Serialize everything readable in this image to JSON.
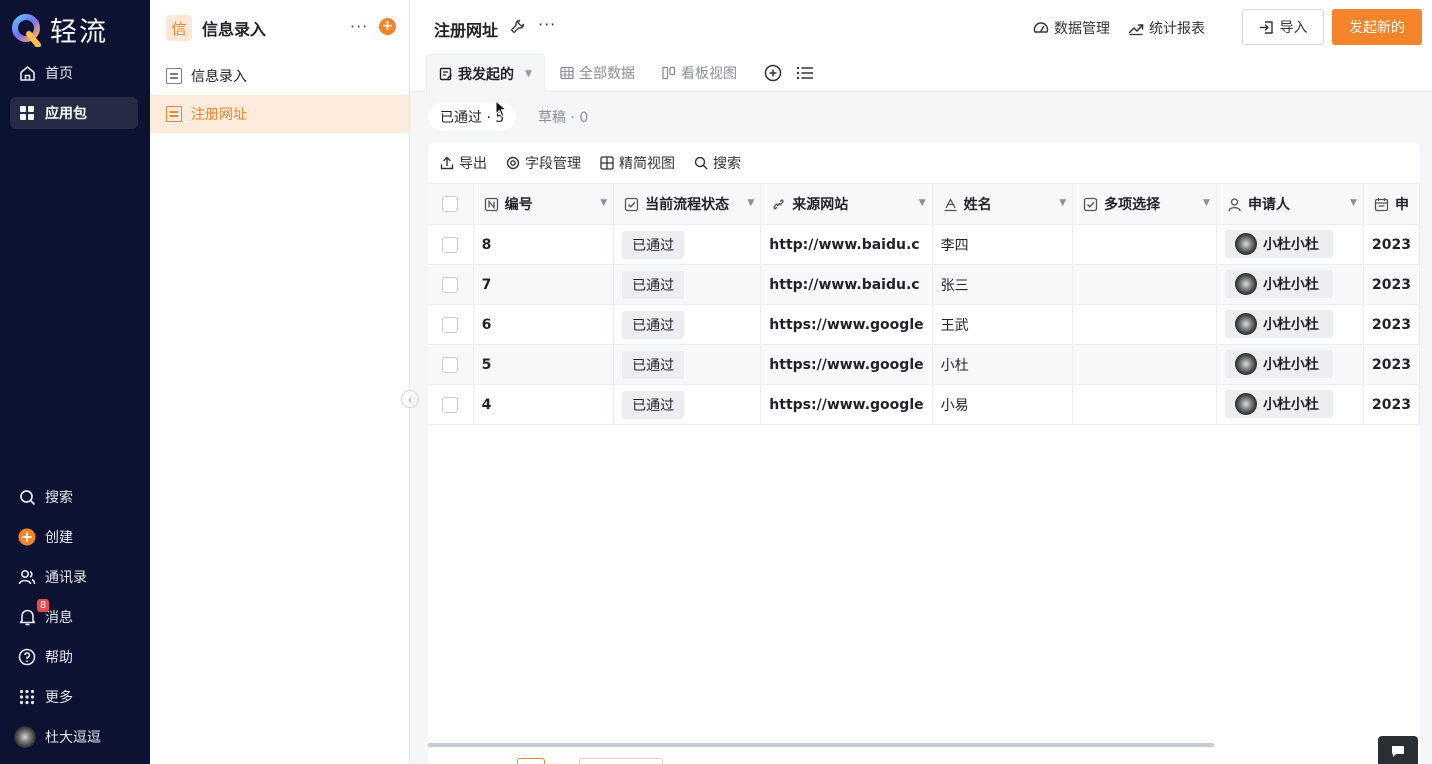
{
  "app": {
    "logo_text": "轻流"
  },
  "rail": {
    "nav": [
      {
        "label": "首页",
        "icon": "home-icon"
      },
      {
        "label": "应用包",
        "icon": "grid-apps-icon",
        "active": true
      }
    ],
    "bottom": [
      {
        "label": "搜索",
        "icon": "search-icon"
      },
      {
        "label": "创建",
        "icon": "plus-circle-icon"
      },
      {
        "label": "通讯录",
        "icon": "contacts-icon"
      },
      {
        "label": "消息",
        "icon": "bell-icon",
        "badge": "8"
      },
      {
        "label": "帮助",
        "icon": "help-icon"
      },
      {
        "label": "更多",
        "icon": "dots-grid-icon"
      }
    ],
    "user": {
      "name": "杜大逗逗"
    }
  },
  "sidebar": {
    "header_icon_char": "信",
    "title": "信息录入",
    "items": [
      {
        "label": "信息录入",
        "active": false
      },
      {
        "label": "注册网址",
        "active": true
      }
    ]
  },
  "header": {
    "title": "注册网址",
    "links": [
      {
        "label": "数据管理",
        "icon": "dashboard-icon"
      },
      {
        "label": "统计报表",
        "icon": "trend-icon"
      }
    ],
    "import_label": "导入",
    "primary_label": "发起新的"
  },
  "view_tabs": [
    {
      "label": "我发起的",
      "icon": "form-icon",
      "active": true
    },
    {
      "label": "全部数据",
      "icon": "table-icon"
    },
    {
      "label": "看板视图",
      "icon": "kanban-icon"
    }
  ],
  "status_pills": {
    "passed": "已通过 · 5",
    "draft": "草稿 · 0"
  },
  "toolbar": {
    "export": "导出",
    "fields": "字段管理",
    "compact": "精简视图",
    "search": "搜索"
  },
  "columns": [
    {
      "label": "编号",
      "icon": "number-field-icon"
    },
    {
      "label": "当前流程状态",
      "icon": "checkbox-field-icon"
    },
    {
      "label": "来源网站",
      "icon": "link-field-icon"
    },
    {
      "label": "姓名",
      "icon": "text-field-icon"
    },
    {
      "label": "多项选择",
      "icon": "checkbox-field-icon"
    },
    {
      "label": "申请人",
      "icon": "person-field-icon"
    },
    {
      "label": "申",
      "icon": "calendar-field-icon"
    }
  ],
  "rows": [
    {
      "id": "8",
      "status": "已通过",
      "url": "http://www.baidu.c",
      "name": "李四",
      "multi": "",
      "applicant": "小杜小杜",
      "date": "2023"
    },
    {
      "id": "7",
      "status": "已通过",
      "url": "http://www.baidu.c",
      "name": "张三",
      "multi": "",
      "applicant": "小杜小杜",
      "date": "2023"
    },
    {
      "id": "6",
      "status": "已通过",
      "url": "https://www.google",
      "name": "王武",
      "multi": "",
      "applicant": "小杜小杜",
      "date": "2023"
    },
    {
      "id": "5",
      "status": "已通过",
      "url": "https://www.google",
      "name": "小杜",
      "multi": "",
      "applicant": "小杜小杜",
      "date": "2023"
    },
    {
      "id": "4",
      "status": "已通过",
      "url": "https://www.google",
      "name": "小易",
      "multi": "",
      "applicant": "小杜小杜",
      "date": "2023"
    }
  ],
  "colors": {
    "rail_bg": "#0c1231",
    "accent": "#f5842a",
    "accent_light": "#fdecde"
  }
}
